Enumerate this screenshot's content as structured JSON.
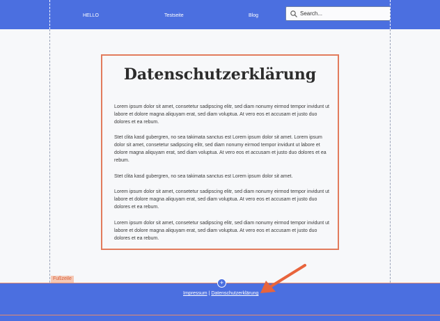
{
  "nav": {
    "items": [
      {
        "label": "HELLO"
      },
      {
        "label": "Testseite"
      },
      {
        "label": "Blog"
      }
    ],
    "search": {
      "placeholder": "Search..."
    }
  },
  "content": {
    "title": "Datenschutzerklärung",
    "paragraphs": [
      "Lorem ipsum dolor sit amet, consetetur sadipscing elitr, sed diam nonumy eirmod tempor invidunt ut labore et dolore magna aliquyam erat, sed diam voluptua. At vero eos et accusam et justo duo dolores et ea rebum.",
      "Stet clita kasd gubergren, no sea takimata sanctus est Lorem ipsum dolor sit amet. Lorem ipsum dolor sit amet, consetetur sadipscing elitr, sed diam nonumy eirmod tempor invidunt ut labore et dolore magna aliquyam erat, sed diam voluptua. At vero eos et accusam et justo duo dolores et ea rebum.",
      "Stet clita kasd gubergren, no sea takimata sanctus est Lorem ipsum dolor sit amet.",
      "Lorem ipsum dolor sit amet, consetetur sadipscing elitr, sed diam nonumy eirmod tempor invidunt ut labore et dolore magna aliquyam erat, sed diam voluptua. At vero eos et accusam et justo duo dolores et ea rebum.",
      "Lorem ipsum dolor sit amet, consetetur sadipscing elitr, sed diam nonumy eirmod tempor invidunt ut labore et dolore magna aliquyam erat, sed diam voluptua. At vero eos et accusam et justo duo dolores et ea rebum."
    ]
  },
  "footer": {
    "tag_label": "Fußzeile",
    "add_label": "+",
    "links": {
      "impressum": "Impressum",
      "separator": " | ",
      "datenschutz": "Datenschutzerklärung"
    }
  },
  "colors": {
    "header_bg": "#4b6fe0",
    "accent_border": "#e27b5c",
    "arrow": "#e8643c"
  },
  "icons": {
    "search": "search-icon",
    "add": "plus-icon",
    "annotation": "arrow-icon"
  }
}
